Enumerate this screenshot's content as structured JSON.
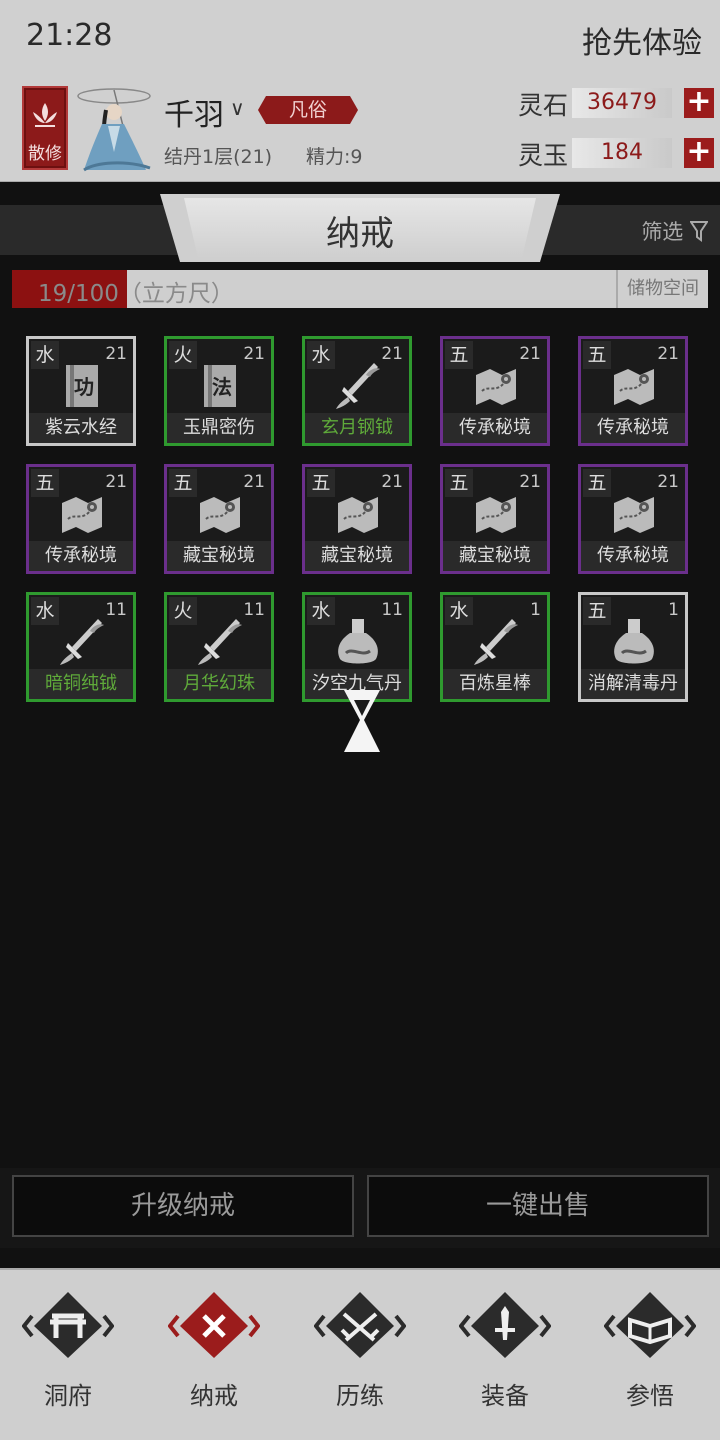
{
  "status": {
    "time": "21:28",
    "early_access": "抢先体验"
  },
  "header": {
    "sect": "散修",
    "player_name": "千羽",
    "name_chevron": "∨",
    "rank": "凡俗",
    "realm": "结丹1层(21)",
    "stamina": "精力:9",
    "currencies": [
      {
        "label": "灵石",
        "value": "36479",
        "add": "+"
      },
      {
        "label": "灵玉",
        "value": "184",
        "add": "+"
      }
    ]
  },
  "page": {
    "title": "纳戒",
    "filter_label": "筛选",
    "capacity_text": "19/100（立方尺）",
    "capacity_fraction": 0.19,
    "storage_label": "储物空间"
  },
  "items": [
    {
      "element": "水",
      "level": "21",
      "name": "紫云水经",
      "quality": "white",
      "icon": "book-icon",
      "glyph": "功"
    },
    {
      "element": "火",
      "level": "21",
      "name": "玉鼎密伤",
      "quality": "green",
      "icon": "book-icon",
      "glyph": "法"
    },
    {
      "element": "水",
      "level": "21",
      "name": "玄月钢钺",
      "quality": "green",
      "icon": "weapon-icon"
    },
    {
      "element": "五",
      "level": "21",
      "name": "传承秘境",
      "quality": "purple",
      "icon": "map-scroll-icon"
    },
    {
      "element": "五",
      "level": "21",
      "name": "传承秘境",
      "quality": "purple",
      "icon": "map-scroll-icon"
    },
    {
      "element": "五",
      "level": "21",
      "name": "传承秘境",
      "quality": "purple",
      "icon": "map-scroll-icon"
    },
    {
      "element": "五",
      "level": "21",
      "name": "藏宝秘境",
      "quality": "purple",
      "icon": "map-scroll-icon"
    },
    {
      "element": "五",
      "level": "21",
      "name": "藏宝秘境",
      "quality": "purple",
      "icon": "map-scroll-icon"
    },
    {
      "element": "五",
      "level": "21",
      "name": "藏宝秘境",
      "quality": "purple",
      "icon": "map-scroll-icon"
    },
    {
      "element": "五",
      "level": "21",
      "name": "传承秘境",
      "quality": "purple",
      "icon": "map-scroll-icon"
    },
    {
      "element": "水",
      "level": "11",
      "name": "暗铜纯钺",
      "quality": "green",
      "icon": "weapon-icon"
    },
    {
      "element": "火",
      "level": "11",
      "name": "月华幻珠",
      "quality": "green",
      "icon": "weapon-icon"
    },
    {
      "element": "水",
      "level": "11",
      "name": "汐空九气丹",
      "quality": "green",
      "icon": "potion-icon"
    },
    {
      "element": "水",
      "level": "1",
      "name": "百炼星棒",
      "quality": "green",
      "icon": "weapon-icon"
    },
    {
      "element": "五",
      "level": "1",
      "name": "消解清毒丹",
      "quality": "white",
      "icon": "potion-icon"
    }
  ],
  "actions": {
    "upgrade": "升级纳戒",
    "sell_all": "一键出售"
  },
  "nav": [
    {
      "label": "洞府",
      "icon": "gate-icon",
      "active": false
    },
    {
      "label": "纳戒",
      "icon": "ring-storage-icon",
      "active": true
    },
    {
      "label": "历练",
      "icon": "crossed-swords-icon",
      "active": false
    },
    {
      "label": "装备",
      "icon": "sword-emblem-icon",
      "active": false
    },
    {
      "label": "参悟",
      "icon": "open-book-icon",
      "active": false
    }
  ],
  "colors": {
    "accent_red": "#8c1a1a",
    "quality_white": "#c8c8c8",
    "quality_green": "#2f9a2f",
    "quality_purple": "#6b2f8c",
    "green_name": "#5faa3a"
  }
}
